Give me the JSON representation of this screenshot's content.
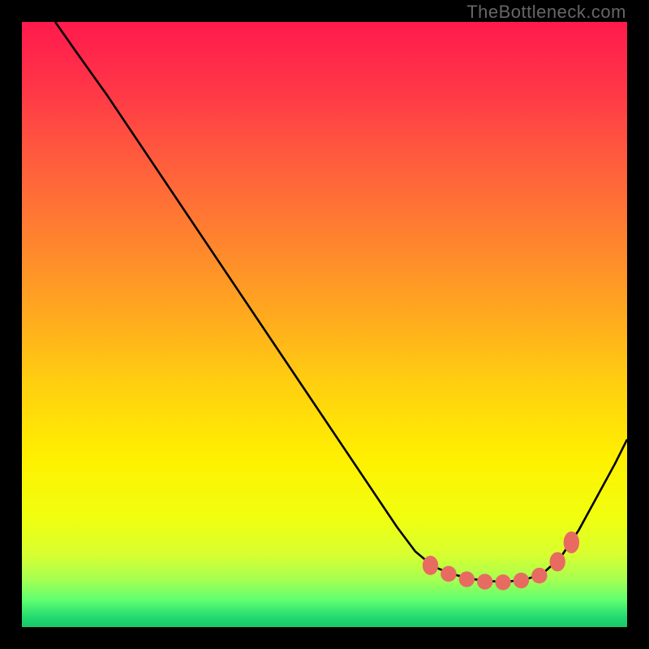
{
  "watermark": "TheBottleneck.com",
  "chart_data": {
    "type": "line",
    "title": "",
    "xlabel": "",
    "ylabel": "",
    "xlim": [
      0,
      100
    ],
    "ylim": [
      0,
      100
    ],
    "curve_points": [
      {
        "x": 5.5,
        "y": 100
      },
      {
        "x": 9,
        "y": 95
      },
      {
        "x": 14,
        "y": 88
      },
      {
        "x": 62,
        "y": 16.5
      },
      {
        "x": 65,
        "y": 12.5
      },
      {
        "x": 68,
        "y": 10
      },
      {
        "x": 71,
        "y": 8.8
      },
      {
        "x": 74,
        "y": 8.0
      },
      {
        "x": 77,
        "y": 7.6
      },
      {
        "x": 80,
        "y": 7.5
      },
      {
        "x": 83,
        "y": 7.8
      },
      {
        "x": 86,
        "y": 8.8
      },
      {
        "x": 89,
        "y": 11.5
      },
      {
        "x": 92,
        "y": 16
      },
      {
        "x": 95,
        "y": 21.5
      },
      {
        "x": 98,
        "y": 27
      },
      {
        "x": 100,
        "y": 31
      }
    ],
    "markers": [
      {
        "x": 67.5,
        "y": 10.2,
        "rx": 1.3,
        "ry": 1.6
      },
      {
        "x": 70.5,
        "y": 8.8,
        "rx": 1.3,
        "ry": 1.3
      },
      {
        "x": 73.5,
        "y": 7.9,
        "rx": 1.3,
        "ry": 1.3
      },
      {
        "x": 76.5,
        "y": 7.5,
        "rx": 1.3,
        "ry": 1.3
      },
      {
        "x": 79.5,
        "y": 7.4,
        "rx": 1.3,
        "ry": 1.3
      },
      {
        "x": 82.5,
        "y": 7.7,
        "rx": 1.3,
        "ry": 1.3
      },
      {
        "x": 85.5,
        "y": 8.5,
        "rx": 1.3,
        "ry": 1.3
      },
      {
        "x": 88.5,
        "y": 10.8,
        "rx": 1.3,
        "ry": 1.6
      },
      {
        "x": 90.8,
        "y": 14.0,
        "rx": 1.3,
        "ry": 1.8
      }
    ],
    "gradient_stops": [
      {
        "pos": 0,
        "color": "#ff1a4d"
      },
      {
        "pos": 0.1,
        "color": "#ff3348"
      },
      {
        "pos": 0.22,
        "color": "#ff5a3e"
      },
      {
        "pos": 0.35,
        "color": "#ff8030"
      },
      {
        "pos": 0.48,
        "color": "#ffa81f"
      },
      {
        "pos": 0.6,
        "color": "#ffd010"
      },
      {
        "pos": 0.72,
        "color": "#fff000"
      },
      {
        "pos": 0.82,
        "color": "#f0ff10"
      },
      {
        "pos": 0.88,
        "color": "#d8ff30"
      },
      {
        "pos": 0.92,
        "color": "#a8ff50"
      },
      {
        "pos": 0.955,
        "color": "#60ff70"
      },
      {
        "pos": 0.985,
        "color": "#20d870"
      },
      {
        "pos": 1.0,
        "color": "#18c868"
      }
    ],
    "marker_color": "#e86b62",
    "curve_color": "#000000"
  }
}
